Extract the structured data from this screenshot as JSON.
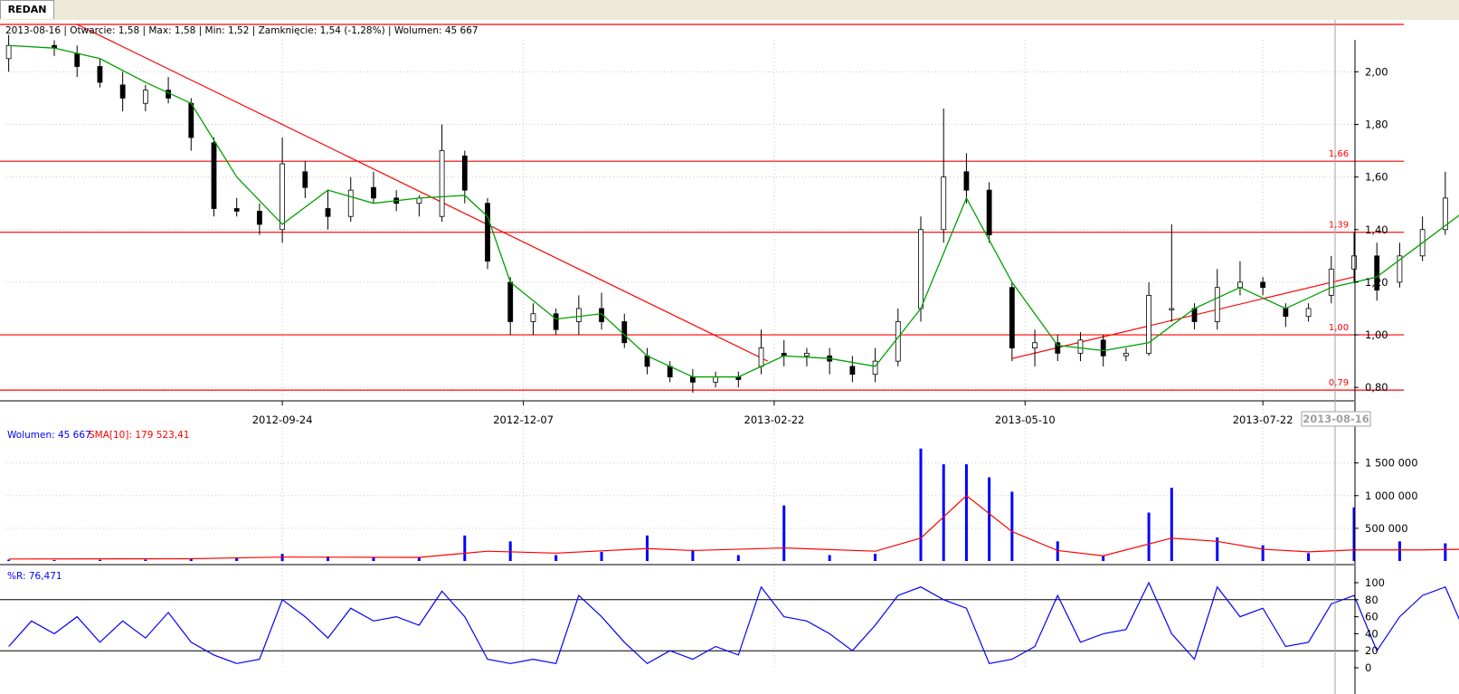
{
  "tab": {
    "label": "REDAN"
  },
  "info_bar": "2013-08-16 | Otwarcie: 1,58 | Max: 1,58 | Min: 1,52 | Zamknięcie: 1,54 (-1,28%)   | Wolumen: 45 667",
  "volume_legend": {
    "volume_label": "Wolumen: 45 667",
    "sma_label": "SMA[10]: 179 523,41"
  },
  "wr_legend": "%R: 76,471",
  "x_ticks": [
    "2012-09-24",
    "2012-12-07",
    "2013-02-22",
    "2013-05-10",
    "2013-07-22"
  ],
  "x_cursor_label": "2013-08-16",
  "colors": {
    "up": "#ffffff",
    "down": "#000000",
    "wick": "#000000",
    "sma": "#00a000",
    "trend": "#ff0000",
    "volume": "#0000ff",
    "volume_sma": "#ff0000",
    "wr": "#0000ff"
  },
  "chart_data": [
    {
      "type": "candlestick",
      "title": "REDAN",
      "ylim": [
        0.78,
        2.18
      ],
      "y_ticks": [
        "0,80",
        "1,00",
        "1,20",
        "1,40",
        "1,60",
        "1,80",
        "2,00"
      ],
      "y_tick_values": [
        0.8,
        1.0,
        1.2,
        1.4,
        1.6,
        1.8,
        2.0
      ],
      "horizontal_levels": [
        {
          "value": 1.66,
          "label": "1,66"
        },
        {
          "value": 1.39,
          "label": "1,39"
        },
        {
          "value": 1.0,
          "label": "1,00"
        },
        {
          "value": 0.79,
          "label": "0,79"
        }
      ],
      "trendlines": [
        {
          "from": [
            "2012-07-23",
            2.18
          ],
          "to": [
            "2013-02-20",
            0.9
          ]
        },
        {
          "from": [
            "2013-05-06",
            0.91
          ],
          "to": [
            "2013-08-19",
            1.22
          ]
        }
      ],
      "x_range": [
        "2012-07-01",
        "2013-08-19"
      ],
      "ohlc": [
        [
          "2012-07-02",
          2.05,
          2.14,
          2.0,
          2.1
        ],
        [
          "2012-07-16",
          2.1,
          2.12,
          2.06,
          2.09
        ],
        [
          "2012-07-23",
          2.07,
          2.1,
          1.98,
          2.02
        ],
        [
          "2012-07-30",
          2.02,
          2.05,
          1.94,
          1.96
        ],
        [
          "2012-08-06",
          1.95,
          2.0,
          1.85,
          1.9
        ],
        [
          "2012-08-13",
          1.88,
          1.95,
          1.85,
          1.93
        ],
        [
          "2012-08-20",
          1.93,
          1.98,
          1.88,
          1.9
        ],
        [
          "2012-08-27",
          1.88,
          1.9,
          1.7,
          1.75
        ],
        [
          "2012-09-03",
          1.73,
          1.75,
          1.45,
          1.48
        ],
        [
          "2012-09-10",
          1.48,
          1.52,
          1.45,
          1.47
        ],
        [
          "2012-09-17",
          1.47,
          1.5,
          1.38,
          1.42
        ],
        [
          "2012-09-24",
          1.4,
          1.75,
          1.35,
          1.65
        ],
        [
          "2012-10-01",
          1.62,
          1.66,
          1.52,
          1.56
        ],
        [
          "2012-10-08",
          1.48,
          1.55,
          1.4,
          1.45
        ],
        [
          "2012-10-15",
          1.45,
          1.6,
          1.43,
          1.55
        ],
        [
          "2012-10-22",
          1.56,
          1.62,
          1.5,
          1.52
        ],
        [
          "2012-10-29",
          1.52,
          1.55,
          1.47,
          1.5
        ],
        [
          "2012-11-05",
          1.5,
          1.53,
          1.45,
          1.52
        ],
        [
          "2012-11-12",
          1.45,
          1.8,
          1.43,
          1.7
        ],
        [
          "2012-11-19",
          1.68,
          1.7,
          1.5,
          1.55
        ],
        [
          "2012-11-26",
          1.5,
          1.52,
          1.25,
          1.28
        ],
        [
          "2012-12-03",
          1.2,
          1.22,
          1.0,
          1.05
        ],
        [
          "2012-12-10",
          1.05,
          1.12,
          1.0,
          1.08
        ],
        [
          "2012-12-17",
          1.08,
          1.1,
          1.0,
          1.02
        ],
        [
          "2012-12-24",
          1.05,
          1.15,
          1.0,
          1.1
        ],
        [
          "2012-12-31",
          1.1,
          1.16,
          1.02,
          1.05
        ],
        [
          "2013-01-07",
          1.05,
          1.08,
          0.95,
          0.97
        ],
        [
          "2013-01-14",
          0.92,
          0.95,
          0.85,
          0.88
        ],
        [
          "2013-01-21",
          0.88,
          0.9,
          0.82,
          0.84
        ],
        [
          "2013-01-28",
          0.84,
          0.87,
          0.78,
          0.82
        ],
        [
          "2013-02-04",
          0.82,
          0.86,
          0.8,
          0.84
        ],
        [
          "2013-02-11",
          0.84,
          0.86,
          0.8,
          0.83
        ],
        [
          "2013-02-18",
          0.88,
          1.02,
          0.85,
          0.95
        ],
        [
          "2013-02-25",
          0.93,
          0.98,
          0.88,
          0.92
        ],
        [
          "2013-03-04",
          0.92,
          0.95,
          0.88,
          0.93
        ],
        [
          "2013-03-11",
          0.92,
          0.95,
          0.85,
          0.9
        ],
        [
          "2013-03-18",
          0.88,
          0.92,
          0.82,
          0.85
        ],
        [
          "2013-03-25",
          0.85,
          0.95,
          0.82,
          0.9
        ],
        [
          "2013-04-01",
          0.9,
          1.1,
          0.88,
          1.05
        ],
        [
          "2013-04-08",
          1.1,
          1.45,
          1.05,
          1.4
        ],
        [
          "2013-04-15",
          1.4,
          1.86,
          1.35,
          1.6
        ],
        [
          "2013-04-22",
          1.62,
          1.69,
          1.5,
          1.55
        ],
        [
          "2013-04-29",
          1.55,
          1.58,
          1.35,
          1.38
        ],
        [
          "2013-05-06",
          1.18,
          1.2,
          0.9,
          0.95
        ],
        [
          "2013-05-13",
          0.95,
          1.02,
          0.88,
          0.97
        ],
        [
          "2013-05-20",
          0.97,
          1.0,
          0.9,
          0.93
        ],
        [
          "2013-05-27",
          0.93,
          1.01,
          0.9,
          0.98
        ],
        [
          "2013-06-03",
          0.98,
          1.0,
          0.88,
          0.92
        ],
        [
          "2013-06-10",
          0.92,
          0.95,
          0.9,
          0.93
        ],
        [
          "2013-06-17",
          0.93,
          1.2,
          0.92,
          1.15
        ],
        [
          "2013-06-24",
          1.1,
          1.42,
          1.05,
          1.1
        ],
        [
          "2013-07-01",
          1.1,
          1.12,
          1.02,
          1.05
        ],
        [
          "2013-07-08",
          1.05,
          1.25,
          1.02,
          1.18
        ],
        [
          "2013-07-15",
          1.18,
          1.28,
          1.15,
          1.2
        ],
        [
          "2013-07-22",
          1.2,
          1.22,
          1.15,
          1.18
        ],
        [
          "2013-07-29",
          1.1,
          1.12,
          1.03,
          1.07
        ],
        [
          "2013-08-05",
          1.07,
          1.12,
          1.05,
          1.1
        ],
        [
          "2013-08-12",
          1.15,
          1.3,
          1.12,
          1.25
        ],
        [
          "2013-08-19",
          1.25,
          1.39,
          1.2,
          1.3
        ],
        [
          "2013-08-26",
          1.3,
          1.35,
          1.13,
          1.17
        ],
        [
          "2013-09-02",
          1.2,
          1.35,
          1.18,
          1.3
        ],
        [
          "2013-09-09",
          1.3,
          1.45,
          1.28,
          1.4
        ],
        [
          "2013-09-16",
          1.4,
          1.62,
          1.38,
          1.52
        ],
        [
          "2013-09-23",
          1.58,
          1.58,
          1.52,
          1.54
        ]
      ],
      "sma": [
        [
          "2012-07-02",
          2.1
        ],
        [
          "2012-07-16",
          2.09
        ],
        [
          "2012-07-30",
          2.05
        ],
        [
          "2012-08-13",
          1.96
        ],
        [
          "2012-08-27",
          1.88
        ],
        [
          "2012-09-10",
          1.6
        ],
        [
          "2012-09-24",
          1.42
        ],
        [
          "2012-10-08",
          1.55
        ],
        [
          "2012-10-22",
          1.5
        ],
        [
          "2012-11-05",
          1.52
        ],
        [
          "2012-11-19",
          1.53
        ],
        [
          "2012-11-26",
          1.45
        ],
        [
          "2012-12-03",
          1.2
        ],
        [
          "2012-12-17",
          1.06
        ],
        [
          "2012-12-31",
          1.08
        ],
        [
          "2013-01-14",
          0.92
        ],
        [
          "2013-01-28",
          0.84
        ],
        [
          "2013-02-11",
          0.84
        ],
        [
          "2013-02-25",
          0.92
        ],
        [
          "2013-03-11",
          0.91
        ],
        [
          "2013-03-25",
          0.88
        ],
        [
          "2013-04-08",
          1.1
        ],
        [
          "2013-04-22",
          1.52
        ],
        [
          "2013-05-06",
          1.2
        ],
        [
          "2013-05-20",
          0.96
        ],
        [
          "2013-06-03",
          0.94
        ],
        [
          "2013-06-17",
          0.97
        ],
        [
          "2013-07-01",
          1.1
        ],
        [
          "2013-07-15",
          1.18
        ],
        [
          "2013-07-29",
          1.1
        ],
        [
          "2013-08-12",
          1.18
        ],
        [
          "2013-08-26",
          1.22
        ],
        [
          "2013-09-09",
          1.35
        ],
        [
          "2013-09-23",
          1.48
        ]
      ]
    },
    {
      "type": "bar",
      "series_name": "Wolumen",
      "ylim": [
        0,
        1800000
      ],
      "y_ticks": [
        "500 000",
        "1 000 000",
        "1 500 000"
      ],
      "y_tick_values": [
        500000,
        1000000,
        1500000
      ],
      "values": [
        [
          "2012-07-02",
          20000
        ],
        [
          "2012-07-16",
          15000
        ],
        [
          "2012-07-30",
          18000
        ],
        [
          "2012-08-13",
          22000
        ],
        [
          "2012-08-27",
          30000
        ],
        [
          "2012-09-10",
          45000
        ],
        [
          "2012-09-24",
          110000
        ],
        [
          "2012-10-08",
          70000
        ],
        [
          "2012-10-22",
          60000
        ],
        [
          "2012-11-05",
          55000
        ],
        [
          "2012-11-19",
          390000
        ],
        [
          "2012-12-03",
          300000
        ],
        [
          "2012-12-17",
          90000
        ],
        [
          "2012-12-31",
          140000
        ],
        [
          "2013-01-14",
          390000
        ],
        [
          "2013-01-28",
          170000
        ],
        [
          "2013-02-11",
          90000
        ],
        [
          "2013-02-25",
          850000
        ],
        [
          "2013-03-11",
          90000
        ],
        [
          "2013-03-25",
          110000
        ],
        [
          "2013-04-08",
          1720000
        ],
        [
          "2013-04-15",
          1480000
        ],
        [
          "2013-04-22",
          1480000
        ],
        [
          "2013-04-29",
          1280000
        ],
        [
          "2013-05-06",
          1060000
        ],
        [
          "2013-05-20",
          300000
        ],
        [
          "2013-06-03",
          80000
        ],
        [
          "2013-06-17",
          740000
        ],
        [
          "2013-06-24",
          1120000
        ],
        [
          "2013-07-08",
          360000
        ],
        [
          "2013-07-22",
          240000
        ],
        [
          "2013-08-05",
          120000
        ],
        [
          "2013-08-19",
          820000
        ],
        [
          "2013-09-02",
          300000
        ],
        [
          "2013-09-16",
          270000
        ],
        [
          "2013-09-23",
          45667
        ]
      ],
      "sma_series_name": "SMA[10]",
      "sma": [
        [
          "2012-07-02",
          30000
        ],
        [
          "2012-08-27",
          35000
        ],
        [
          "2012-09-24",
          60000
        ],
        [
          "2012-11-05",
          55000
        ],
        [
          "2012-11-26",
          150000
        ],
        [
          "2012-12-17",
          120000
        ],
        [
          "2013-01-14",
          190000
        ],
        [
          "2013-01-28",
          160000
        ],
        [
          "2013-02-25",
          200000
        ],
        [
          "2013-03-25",
          150000
        ],
        [
          "2013-04-08",
          350000
        ],
        [
          "2013-04-22",
          1000000
        ],
        [
          "2013-05-06",
          450000
        ],
        [
          "2013-05-20",
          160000
        ],
        [
          "2013-06-03",
          80000
        ],
        [
          "2013-06-24",
          350000
        ],
        [
          "2013-07-08",
          300000
        ],
        [
          "2013-07-22",
          180000
        ],
        [
          "2013-08-05",
          140000
        ],
        [
          "2013-08-19",
          170000
        ],
        [
          "2013-09-09",
          170000
        ],
        [
          "2013-09-23",
          180000
        ]
      ]
    },
    {
      "type": "line",
      "series_name": "%R",
      "ylim": [
        0,
        100
      ],
      "y_ticks": [
        "0",
        "20",
        "40",
        "60",
        "80",
        "100"
      ],
      "y_tick_values": [
        0,
        20,
        40,
        60,
        80,
        100
      ],
      "levels": [
        20,
        80
      ],
      "values": [
        [
          "2012-07-02",
          25
        ],
        [
          "2012-07-09",
          55
        ],
        [
          "2012-07-16",
          40
        ],
        [
          "2012-07-23",
          60
        ],
        [
          "2012-07-30",
          30
        ],
        [
          "2012-08-06",
          55
        ],
        [
          "2012-08-13",
          35
        ],
        [
          "2012-08-20",
          65
        ],
        [
          "2012-08-27",
          30
        ],
        [
          "2012-09-03",
          15
        ],
        [
          "2012-09-10",
          5
        ],
        [
          "2012-09-17",
          10
        ],
        [
          "2012-09-24",
          80
        ],
        [
          "2012-10-01",
          60
        ],
        [
          "2012-10-08",
          35
        ],
        [
          "2012-10-15",
          70
        ],
        [
          "2012-10-22",
          55
        ],
        [
          "2012-10-29",
          60
        ],
        [
          "2012-11-05",
          50
        ],
        [
          "2012-11-12",
          90
        ],
        [
          "2012-11-19",
          60
        ],
        [
          "2012-11-26",
          10
        ],
        [
          "2012-12-03",
          5
        ],
        [
          "2012-12-10",
          10
        ],
        [
          "2012-12-17",
          5
        ],
        [
          "2012-12-24",
          85
        ],
        [
          "2012-12-31",
          60
        ],
        [
          "2013-01-07",
          30
        ],
        [
          "2013-01-14",
          5
        ],
        [
          "2013-01-21",
          20
        ],
        [
          "2013-01-28",
          10
        ],
        [
          "2013-02-04",
          25
        ],
        [
          "2013-02-11",
          15
        ],
        [
          "2013-02-18",
          95
        ],
        [
          "2013-02-25",
          60
        ],
        [
          "2013-03-04",
          55
        ],
        [
          "2013-03-11",
          40
        ],
        [
          "2013-03-18",
          20
        ],
        [
          "2013-03-25",
          50
        ],
        [
          "2013-04-01",
          85
        ],
        [
          "2013-04-08",
          95
        ],
        [
          "2013-04-15",
          80
        ],
        [
          "2013-04-22",
          70
        ],
        [
          "2013-04-29",
          5
        ],
        [
          "2013-05-06",
          10
        ],
        [
          "2013-05-13",
          25
        ],
        [
          "2013-05-20",
          85
        ],
        [
          "2013-05-27",
          30
        ],
        [
          "2013-06-03",
          40
        ],
        [
          "2013-06-10",
          45
        ],
        [
          "2013-06-17",
          100
        ],
        [
          "2013-06-24",
          40
        ],
        [
          "2013-07-01",
          10
        ],
        [
          "2013-07-08",
          95
        ],
        [
          "2013-07-15",
          60
        ],
        [
          "2013-07-22",
          70
        ],
        [
          "2013-07-29",
          25
        ],
        [
          "2013-08-05",
          30
        ],
        [
          "2013-08-12",
          75
        ],
        [
          "2013-08-19",
          85
        ],
        [
          "2013-08-26",
          20
        ],
        [
          "2013-09-02",
          60
        ],
        [
          "2013-09-09",
          85
        ],
        [
          "2013-09-16",
          95
        ],
        [
          "2013-09-23",
          33
        ]
      ]
    }
  ]
}
